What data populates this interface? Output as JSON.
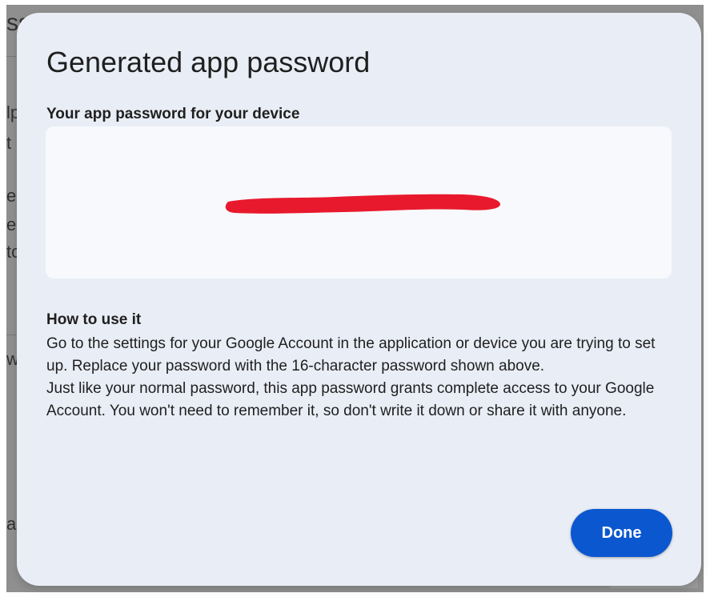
{
  "background": {
    "fragments": [
      "ss",
      "lp",
      "t",
      "e",
      "e",
      "to",
      "w",
      "ap"
    ]
  },
  "dialog": {
    "title": "Generated app password",
    "password_label": "Your app password for your device",
    "password_value": "",
    "howto_heading": "How to use it",
    "howto_paragraph_1": "Go to the settings for your Google Account in the application or device you are trying to set up. Replace your password with the 16-character password shown above.",
    "howto_paragraph_2": "Just like your normal password, this app password grants complete access to your Google Account. You won't need to remember it, so don't write it down or share it with anyone.",
    "done_label": "Done"
  },
  "colors": {
    "dialog_background": "#e9edf5",
    "password_box": "#f8f9fd",
    "primary_button": "#0b57d0",
    "redaction_mark": "#e8192c"
  }
}
